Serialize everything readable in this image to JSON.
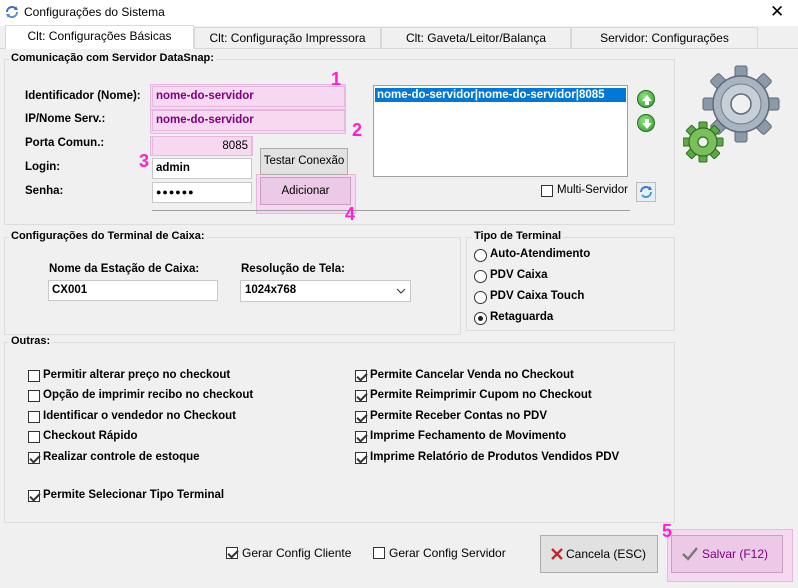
{
  "window": {
    "title": "Configurações do Sistema"
  },
  "tabs": [
    {
      "label": "Clt: Configurações Básicas",
      "active": true
    },
    {
      "label": "Clt: Configuração Impressora",
      "active": false
    },
    {
      "label": "Clt: Gaveta/Leitor/Balança",
      "active": false
    },
    {
      "label": "Servidor: Configurações",
      "active": false
    }
  ],
  "datasnap": {
    "group_label": "Comunicação com Servidor DataSnap:",
    "identificador_label": "Identificador (Nome):",
    "identificador_value": "nome-do-servidor",
    "ip_label": "IP/Nome Serv.:",
    "ip_value": "nome-do-servidor",
    "porta_label": "Porta Comun.:",
    "porta_value": "8085",
    "login_label": "Login:",
    "login_value": "admin",
    "senha_label": "Senha:",
    "senha_value": "●●●●●●",
    "test_button": "Testar Conexão",
    "add_button": "Adicionar",
    "server_list": [
      "nome-do-servidor|nome-do-servidor|8085"
    ],
    "multi_servidor_label": "Multi-Servidor",
    "multi_servidor_checked": false
  },
  "terminal": {
    "group_label": "Configurações do Terminal de Caixa:",
    "estacao_label": "Nome da Estação de Caixa:",
    "estacao_value": "CX001",
    "resolucao_label": "Resolução de Tela:",
    "resolucao_value": "1024x768"
  },
  "tipo_terminal": {
    "group_label": "Tipo de Terminal",
    "options": [
      {
        "label": "Auto-Atendimento",
        "checked": false
      },
      {
        "label": "PDV Caixa",
        "checked": false
      },
      {
        "label": "PDV Caixa Touch",
        "checked": false
      },
      {
        "label": "Retaguarda",
        "checked": true
      }
    ]
  },
  "outras": {
    "group_label": "Outras:",
    "left": [
      {
        "label": "Permitir alterar preço no checkout",
        "checked": false
      },
      {
        "label": "Opção de imprimir recibo no checkout",
        "checked": false
      },
      {
        "label": "Identificar o vendedor no Checkout",
        "checked": false
      },
      {
        "label": "Checkout Rápido",
        "checked": false
      },
      {
        "label": "Realizar controle de estoque",
        "checked": true
      }
    ],
    "right": [
      {
        "label": "Permite Cancelar Venda no Checkout",
        "checked": true
      },
      {
        "label": "Permite Reimprimir Cupom no Checkout",
        "checked": true
      },
      {
        "label": "Permite Receber Contas no PDV",
        "checked": true
      },
      {
        "label": "Imprime Fechamento de Movimento",
        "checked": true
      },
      {
        "label": "Imprime Relatório de Produtos Vendidos PDV",
        "checked": true
      }
    ],
    "bottom": {
      "label": "Permite Selecionar Tipo Terminal",
      "checked": true
    }
  },
  "footer": {
    "gerar_cliente_label": "Gerar Config Cliente",
    "gerar_cliente_checked": true,
    "gerar_servidor_label": "Gerar Config Servidor",
    "gerar_servidor_checked": false,
    "cancel_button": "Cancela (ESC)",
    "save_button": "Salvar (F12)"
  },
  "annotations": [
    "1",
    "2",
    "3",
    "4",
    "5"
  ],
  "colors": {
    "highlight": "#f7d8f1",
    "annotation": "#ff1fcf",
    "selection": "#0078d7",
    "value_text": "#800080"
  }
}
